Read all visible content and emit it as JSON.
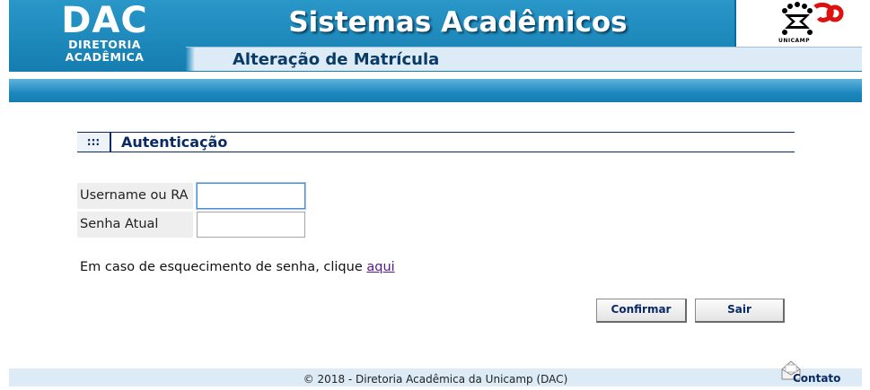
{
  "header": {
    "logo_main": "DAC",
    "logo_line1": "DIRETORIA",
    "logo_line2": "ACADÊMICA",
    "system_title": "Sistemas Acadêmicos",
    "page_subtitle": "Alteração de Matrícula",
    "partner_logo_text": "UNICAMP",
    "partner_logo_icon": "unicamp-50-logo"
  },
  "auth": {
    "section_marker": ":::",
    "section_title": "Autenticação",
    "username_label": "Username ou RA",
    "username_value": "",
    "password_label": "Senha Atual",
    "password_value": "",
    "forgot_text": "Em caso de esquecimento de senha, clique",
    "forgot_link": "aqui",
    "confirm_button": "Confirmar",
    "exit_button": "Sair"
  },
  "footer": {
    "copyright": "© 2018 - Diretoria Acadêmica da Unicamp (DAC)",
    "contact_label": "Contato",
    "contact_icon": "envelope-icon"
  },
  "colors": {
    "header_blue": "#1d88bd",
    "light_blue": "#dcebf5",
    "navy": "#0a2a66",
    "link_visited": "#551a8b"
  }
}
